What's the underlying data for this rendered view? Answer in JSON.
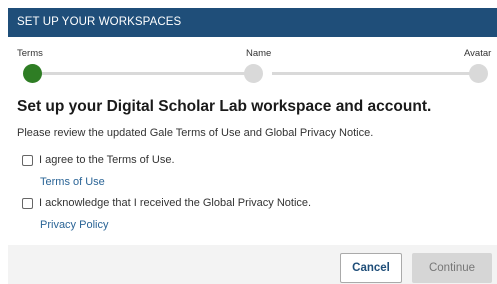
{
  "header": {
    "title": "SET UP YOUR WORKSPACES"
  },
  "steps": [
    {
      "label": "Terms",
      "state": "active"
    },
    {
      "label": "Name",
      "state": "inactive"
    },
    {
      "label": "Avatar",
      "state": "inactive"
    }
  ],
  "content": {
    "title": "Set up your Digital Scholar Lab workspace and account.",
    "description": "Please review the updated Gale Terms of Use and Global Privacy Notice.",
    "checks": [
      {
        "label": "I agree to the Terms of Use.",
        "checked": false,
        "link": "Terms of Use"
      },
      {
        "label": "I acknowledge that I received the Global Privacy Notice.",
        "checked": false,
        "link": "Privacy Policy"
      }
    ]
  },
  "actions": {
    "cancel": "Cancel",
    "continue": "Continue"
  },
  "colors": {
    "header": "#1f4e79",
    "active_step": "#2e7d24",
    "link": "#2a6496"
  }
}
